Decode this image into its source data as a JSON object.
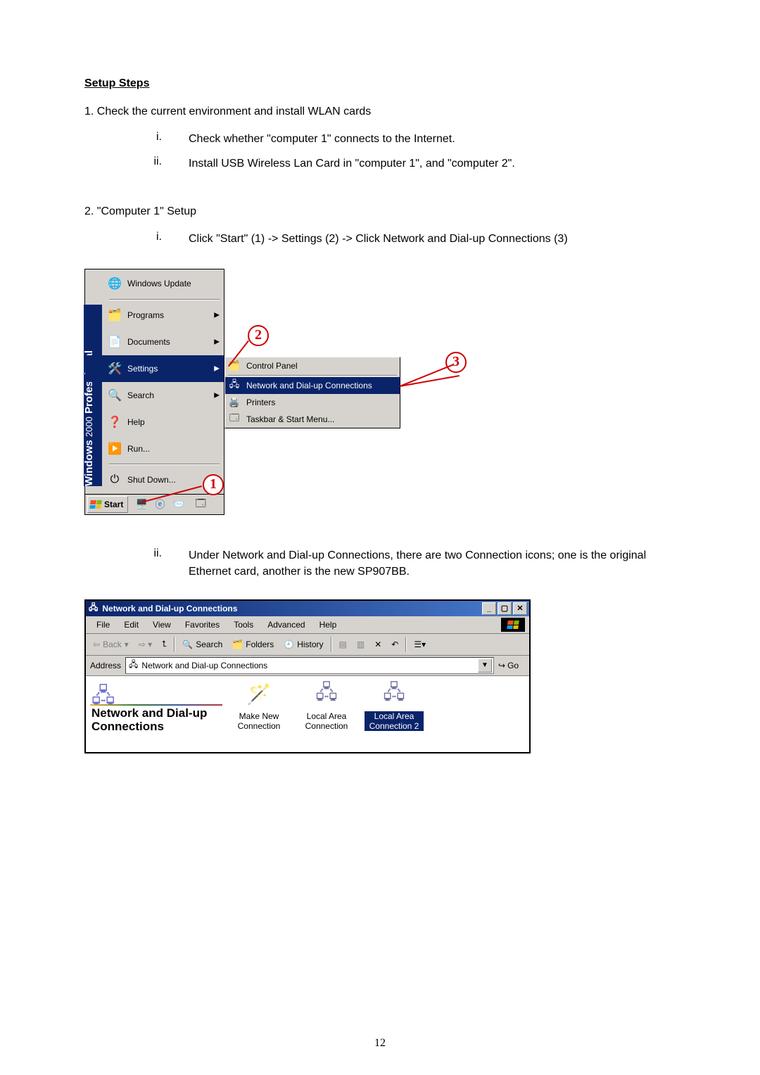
{
  "heading": "Setup Steps ",
  "step1_line": "1. Check the current environment and install WLAN cards",
  "step1": {
    "i_roman": "i.",
    "i_txt": "Check whether \"computer 1\" connects to the Internet.",
    "ii_roman": "ii.",
    "ii_txt": "Install USB Wireless Lan Card in \"computer 1\", and \"computer 2\"."
  },
  "step2_line": "2. \"Computer 1\" Setup",
  "step2": {
    "i_roman": "i.",
    "i_txt": "Click \"Start\" (1) -> Settings (2) -> Click Network and Dial-up Connections (3)",
    "ii_roman": "ii.",
    "ii_txt": "Under Network and Dial-up Connections, there are two Connection icons; one is the original Ethernet card, another is the new SP907BB."
  },
  "startmenu": {
    "banner_line1": "Windows",
    "banner_line2": "2000",
    "banner_line3": "Professional",
    "wu": "Windows Update",
    "programs": "Programs",
    "documents": "Documents",
    "settings": "Settings",
    "search": "Search",
    "help": "Help",
    "run": "Run...",
    "shutdown": "Shut Down...",
    "start": "Start"
  },
  "submenu": {
    "control_panel": "Control Panel",
    "netdial": "Network and Dial-up Connections",
    "printers": "Printers",
    "taskbar": "Taskbar & Start Menu..."
  },
  "callouts": {
    "c1": "1",
    "c2": "2",
    "c3": "3"
  },
  "explorer": {
    "title": "Network and Dial-up Connections",
    "menu": {
      "file": "File",
      "edit": "Edit",
      "view": "View",
      "fav": "Favorites",
      "tools": "Tools",
      "adv": "Advanced",
      "help": "Help"
    },
    "tb": {
      "back": "Back",
      "search": "Search",
      "folders": "Folders",
      "history": "History"
    },
    "address_label": "Address",
    "address_text": "Network and Dial-up Connections",
    "go": "Go",
    "left_title": "Network and Dial-up Connections",
    "items": {
      "make": "Make New Connection",
      "lac": "Local Area Connection",
      "lac2": "Local Area Connection 2"
    }
  },
  "page_number": "12"
}
